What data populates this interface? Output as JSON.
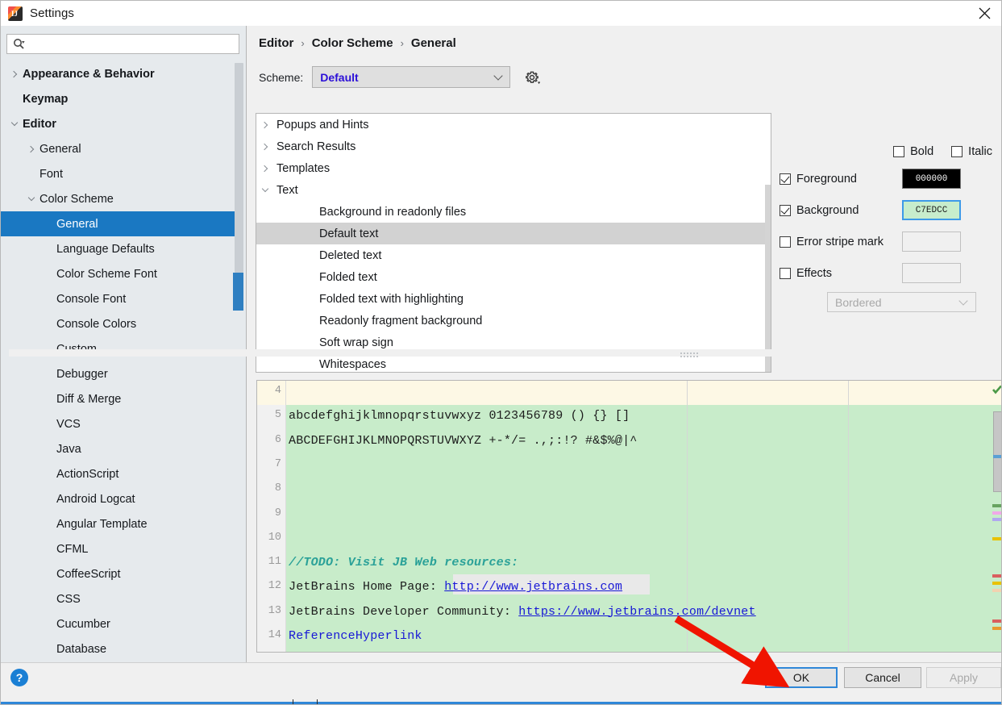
{
  "window": {
    "title": "Settings",
    "app_icon": "intellij-idea-icon",
    "close_icon": "close-icon"
  },
  "search": {
    "placeholder": "",
    "value": "",
    "icon": "search-icon"
  },
  "sidebar": {
    "items": [
      {
        "label": "Appearance & Behavior",
        "indent": 0,
        "chevron": "right",
        "bold": true,
        "selected": false
      },
      {
        "label": "Keymap",
        "indent": 0,
        "chevron": "none",
        "bold": true,
        "selected": false
      },
      {
        "label": "Editor",
        "indent": 0,
        "chevron": "down",
        "bold": true,
        "selected": false
      },
      {
        "label": "General",
        "indent": 1,
        "chevron": "right",
        "bold": false,
        "selected": false
      },
      {
        "label": "Font",
        "indent": 1,
        "chevron": "none",
        "bold": false,
        "selected": false
      },
      {
        "label": "Color Scheme",
        "indent": 1,
        "chevron": "down",
        "bold": false,
        "selected": false
      },
      {
        "label": "General",
        "indent": 2,
        "chevron": "none",
        "bold": false,
        "selected": true
      },
      {
        "label": "Language Defaults",
        "indent": 2,
        "chevron": "none",
        "bold": false,
        "selected": false
      },
      {
        "label": "Color Scheme Font",
        "indent": 2,
        "chevron": "none",
        "bold": false,
        "selected": false
      },
      {
        "label": "Console Font",
        "indent": 2,
        "chevron": "none",
        "bold": false,
        "selected": false
      },
      {
        "label": "Console Colors",
        "indent": 2,
        "chevron": "none",
        "bold": false,
        "selected": false
      },
      {
        "label": "Custom",
        "indent": 2,
        "chevron": "none",
        "bold": false,
        "selected": false
      },
      {
        "label": "Debugger",
        "indent": 2,
        "chevron": "none",
        "bold": false,
        "selected": false
      },
      {
        "label": "Diff & Merge",
        "indent": 2,
        "chevron": "none",
        "bold": false,
        "selected": false
      },
      {
        "label": "VCS",
        "indent": 2,
        "chevron": "none",
        "bold": false,
        "selected": false
      },
      {
        "label": "Java",
        "indent": 2,
        "chevron": "none",
        "bold": false,
        "selected": false
      },
      {
        "label": "ActionScript",
        "indent": 2,
        "chevron": "none",
        "bold": false,
        "selected": false
      },
      {
        "label": "Android Logcat",
        "indent": 2,
        "chevron": "none",
        "bold": false,
        "selected": false
      },
      {
        "label": "Angular Template",
        "indent": 2,
        "chevron": "none",
        "bold": false,
        "selected": false
      },
      {
        "label": "CFML",
        "indent": 2,
        "chevron": "none",
        "bold": false,
        "selected": false
      },
      {
        "label": "CoffeeScript",
        "indent": 2,
        "chevron": "none",
        "bold": false,
        "selected": false
      },
      {
        "label": "CSS",
        "indent": 2,
        "chevron": "none",
        "bold": false,
        "selected": false
      },
      {
        "label": "Cucumber",
        "indent": 2,
        "chevron": "none",
        "bold": false,
        "selected": false
      },
      {
        "label": "Database",
        "indent": 2,
        "chevron": "none",
        "bold": false,
        "selected": false
      }
    ]
  },
  "breadcrumb": {
    "items": [
      "Editor",
      "Color Scheme",
      "General"
    ],
    "separator": "›"
  },
  "scheme": {
    "label": "Scheme:",
    "value": "Default",
    "gear_icon": "gear-icon",
    "chevron_icon": "chevron-down-icon"
  },
  "options_tree": [
    {
      "label": "Popups and Hints",
      "chevron": "right",
      "indent": false,
      "selected": false
    },
    {
      "label": "Search Results",
      "chevron": "right",
      "indent": false,
      "selected": false
    },
    {
      "label": "Templates",
      "chevron": "right",
      "indent": false,
      "selected": false
    },
    {
      "label": "Text",
      "chevron": "down",
      "indent": false,
      "selected": false
    },
    {
      "label": "Background in readonly files",
      "chevron": "none",
      "indent": true,
      "selected": false
    },
    {
      "label": "Default text",
      "chevron": "none",
      "indent": true,
      "selected": true
    },
    {
      "label": "Deleted text",
      "chevron": "none",
      "indent": true,
      "selected": false
    },
    {
      "label": "Folded text",
      "chevron": "none",
      "indent": true,
      "selected": false
    },
    {
      "label": "Folded text with highlighting",
      "chevron": "none",
      "indent": true,
      "selected": false
    },
    {
      "label": "Readonly fragment background",
      "chevron": "none",
      "indent": true,
      "selected": false
    },
    {
      "label": "Soft wrap sign",
      "chevron": "none",
      "indent": true,
      "selected": false
    },
    {
      "label": "Whitespaces",
      "chevron": "none",
      "indent": true,
      "selected": false
    }
  ],
  "attributes": {
    "bold": {
      "label": "Bold",
      "checked": false
    },
    "italic": {
      "label": "Italic",
      "checked": false
    },
    "foreground": {
      "label": "Foreground",
      "checked": true,
      "color": "000000",
      "swatch_hex": "#000000"
    },
    "background": {
      "label": "Background",
      "checked": true,
      "color": "C7EDCC",
      "swatch_hex": "#C7EDCC"
    },
    "error_stripe": {
      "label": "Error stripe mark",
      "checked": false,
      "color": ""
    },
    "effects": {
      "label": "Effects",
      "checked": false,
      "color": "",
      "type_value": "Bordered"
    }
  },
  "preview": {
    "lines": [
      {
        "num": "4",
        "text": ""
      },
      {
        "num": "5",
        "text": "abcdefghijklmnopqrstuvwxyz 0123456789 () {} []"
      },
      {
        "num": "6",
        "text": "ABCDEFGHIJKLMNOPQRSTUVWXYZ +-*/= .,;:!? #&$%@|^"
      },
      {
        "num": "7",
        "text": ""
      },
      {
        "num": "8",
        "text": ""
      },
      {
        "num": "9",
        "text": ""
      },
      {
        "num": "10",
        "text": ""
      },
      {
        "num": "11",
        "text": "//TODO: Visit JB Web resources:"
      },
      {
        "num": "12",
        "text": "JetBrains Home Page: ",
        "link": "http://www.jetbrains.com"
      },
      {
        "num": "13",
        "text": "JetBrains Developer Community: ",
        "link": "https://www.jetbrains.com/devnet"
      },
      {
        "num": "14",
        "text": "ReferenceHyperlink"
      }
    ],
    "inspection_icon": "inspections-ok-check-icon",
    "stripe_colors": [
      "#67a360",
      "#f0a8e8",
      "#b0a8f0",
      "#e8c200",
      "#d95f5f",
      "#e8c200",
      "#f2d2b0",
      "#d95f5f",
      "#e89a2e"
    ]
  },
  "footer": {
    "help_icon": "help-icon",
    "help_label": "?",
    "ok": "OK",
    "cancel": "Cancel",
    "apply": "Apply"
  },
  "annotation": {
    "type": "red-arrow",
    "color": "#f01400"
  }
}
